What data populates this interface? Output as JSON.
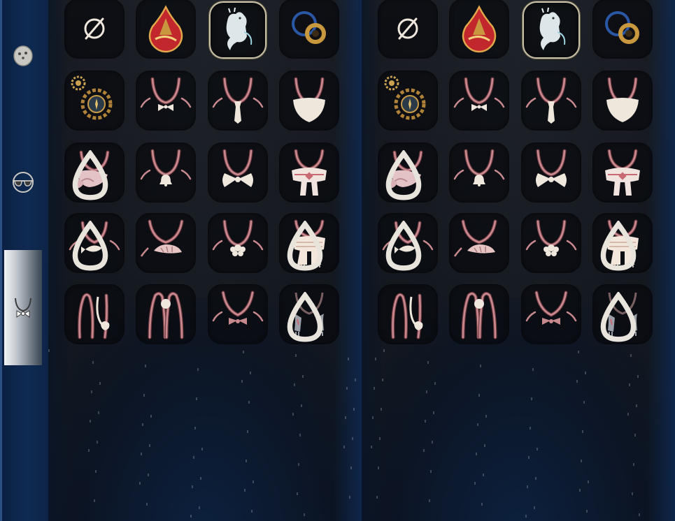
{
  "sidebar": {
    "tabs": [
      {
        "icon": "mask-icon",
        "active": false
      },
      {
        "icon": "glasses-icon",
        "active": false
      },
      {
        "icon": "necklace-tab-icon",
        "active": true
      }
    ]
  },
  "panels": [
    {
      "rows": [
        [
          {
            "icon": "none-icon"
          },
          {
            "icon": "flame-pendant-icon"
          },
          {
            "icon": "spirit-creature-icon",
            "selected": true
          },
          {
            "icon": "ring-orb-icon"
          }
        ],
        [
          {
            "icon": "gear-medallion-icon"
          },
          {
            "icon": "bowtie-necklace-icon"
          },
          {
            "icon": "tie-necklace-icon"
          },
          {
            "icon": "beard-necklace-icon"
          }
        ],
        [
          {
            "icon": "scarf-necklace-icon",
            "ultimate": true
          },
          {
            "icon": "bell-necklace-icon"
          },
          {
            "icon": "big-bow-necklace-icon"
          },
          {
            "icon": "patterned-scarf-icon"
          }
        ],
        [
          {
            "icon": "fish-necklace-icon",
            "ultimate": true
          },
          {
            "icon": "shell-necklace-icon"
          },
          {
            "icon": "flower-necklace-icon"
          },
          {
            "icon": "knit-scarf-icon",
            "ultimate": true
          }
        ],
        [
          {
            "icon": "long-string-hand-icon"
          },
          {
            "icon": "long-string-pearl-icon"
          },
          {
            "icon": "ribbon-necklace-icon"
          },
          {
            "icon": "tassel-necklace-icon",
            "ultimate": true
          }
        ]
      ]
    },
    {
      "rows": [
        [
          {
            "icon": "none-icon"
          },
          {
            "icon": "flame-pendant-icon"
          },
          {
            "icon": "spirit-creature-icon",
            "selected": true
          },
          {
            "icon": "ring-orb-icon"
          }
        ],
        [
          {
            "icon": "gear-medallion-icon"
          },
          {
            "icon": "bowtie-necklace-icon"
          },
          {
            "icon": "tie-necklace-icon"
          },
          {
            "icon": "beard-necklace-icon"
          }
        ],
        [
          {
            "icon": "scarf-necklace-icon",
            "ultimate": true
          },
          {
            "icon": "bell-necklace-icon"
          },
          {
            "icon": "big-bow-necklace-icon"
          },
          {
            "icon": "patterned-scarf-icon"
          }
        ],
        [
          {
            "icon": "fish-necklace-icon",
            "ultimate": true
          },
          {
            "icon": "shell-necklace-icon"
          },
          {
            "icon": "flower-necklace-icon"
          },
          {
            "icon": "knit-scarf-icon",
            "ultimate": true
          }
        ],
        [
          {
            "icon": "long-string-hand-icon"
          },
          {
            "icon": "long-string-pearl-icon"
          },
          {
            "icon": "ribbon-necklace-icon"
          },
          {
            "icon": "tassel-necklace-icon",
            "ultimate": true
          }
        ]
      ]
    }
  ],
  "colors": {
    "cord": "#c98a8f",
    "cordDark": "#6e3a40",
    "ornament": "#efe6dc",
    "flame": "#c2272d",
    "gold": "#c9973e",
    "selectedBorder": "#c7bfa5"
  }
}
